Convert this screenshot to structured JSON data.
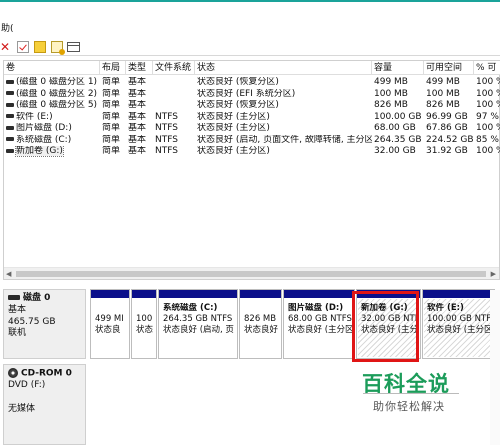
{
  "menu": {
    "action_label": "助("
  },
  "toolbar": {
    "icons": [
      "close-icon",
      "check-icon",
      "document-icon",
      "help-icon",
      "window-icon"
    ]
  },
  "columns": [
    "卷",
    "布局",
    "类型",
    "文件系统",
    "状态",
    "容量",
    "可用空间",
    "% 可"
  ],
  "volumes": [
    {
      "name": "(磁盘 0 磁盘分区 1)",
      "layout": "简单",
      "type": "基本",
      "fs": "",
      "status": "状态良好 (恢复分区)",
      "capacity": "499 MB",
      "free": "499 MB",
      "pct": "100 %"
    },
    {
      "name": "(磁盘 0 磁盘分区 2)",
      "layout": "简单",
      "type": "基本",
      "fs": "",
      "status": "状态良好 (EFI 系统分区)",
      "capacity": "100 MB",
      "free": "100 MB",
      "pct": "100 %"
    },
    {
      "name": "(磁盘 0 磁盘分区 5)",
      "layout": "简单",
      "type": "基本",
      "fs": "",
      "status": "状态良好 (恢复分区)",
      "capacity": "826 MB",
      "free": "826 MB",
      "pct": "100 %"
    },
    {
      "name": "软件 (E:)",
      "layout": "简单",
      "type": "基本",
      "fs": "NTFS",
      "status": "状态良好 (主分区)",
      "capacity": "100.00 GB",
      "free": "96.99 GB",
      "pct": "97 %"
    },
    {
      "name": "图片磁盘 (D:)",
      "layout": "简单",
      "type": "基本",
      "fs": "NTFS",
      "status": "状态良好 (主分区)",
      "capacity": "68.00 GB",
      "free": "67.86 GB",
      "pct": "100 %"
    },
    {
      "name": "系统磁盘 (C:)",
      "layout": "简单",
      "type": "基本",
      "fs": "NTFS",
      "status": "状态良好 (启动, 页面文件, 故障转储, 主分区)",
      "capacity": "264.35 GB",
      "free": "224.52 GB",
      "pct": "85 %"
    },
    {
      "name": "新加卷 (G:)",
      "layout": "简单",
      "type": "基本",
      "fs": "NTFS",
      "status": "状态良好 (主分区)",
      "capacity": "32.00 GB",
      "free": "31.92 GB",
      "pct": "100 %"
    }
  ],
  "disk0": {
    "name": "磁盘 0",
    "type": "基本",
    "size": "465.75 GB",
    "state": "联机",
    "partitions": [
      {
        "line1": "",
        "line2": "499 MI",
        "line3": "状态良",
        "hatched": false
      },
      {
        "line1": "",
        "line2": "100",
        "line3": "状态",
        "hatched": false
      },
      {
        "line1": "系统磁盘 (C:)",
        "line2": "264.35 GB NTFS",
        "line3": "状态良好 (启动, 页",
        "hatched": false
      },
      {
        "line1": "",
        "line2": "826 MB",
        "line3": "状态良好",
        "hatched": false
      },
      {
        "line1": "图片磁盘 (D:)",
        "line2": "68.00 GB NTFS",
        "line3": "状态良好 (主分区)",
        "hatched": false
      },
      {
        "line1": "新加卷 (G:)",
        "line2": "32.00 GB NTF",
        "line3": "状态良好 (主分",
        "hatched": true
      },
      {
        "line1": "软件 (E:)",
        "line2": "100.00 GB NTFS",
        "line3": "状态良好 (主分区)",
        "hatched": true
      }
    ]
  },
  "cdrom0": {
    "name": "CD-ROM 0",
    "type": "DVD (F:)",
    "state": "无媒体"
  },
  "watermark": {
    "title": "百科全说",
    "subtitle": "助你轻松解决"
  }
}
